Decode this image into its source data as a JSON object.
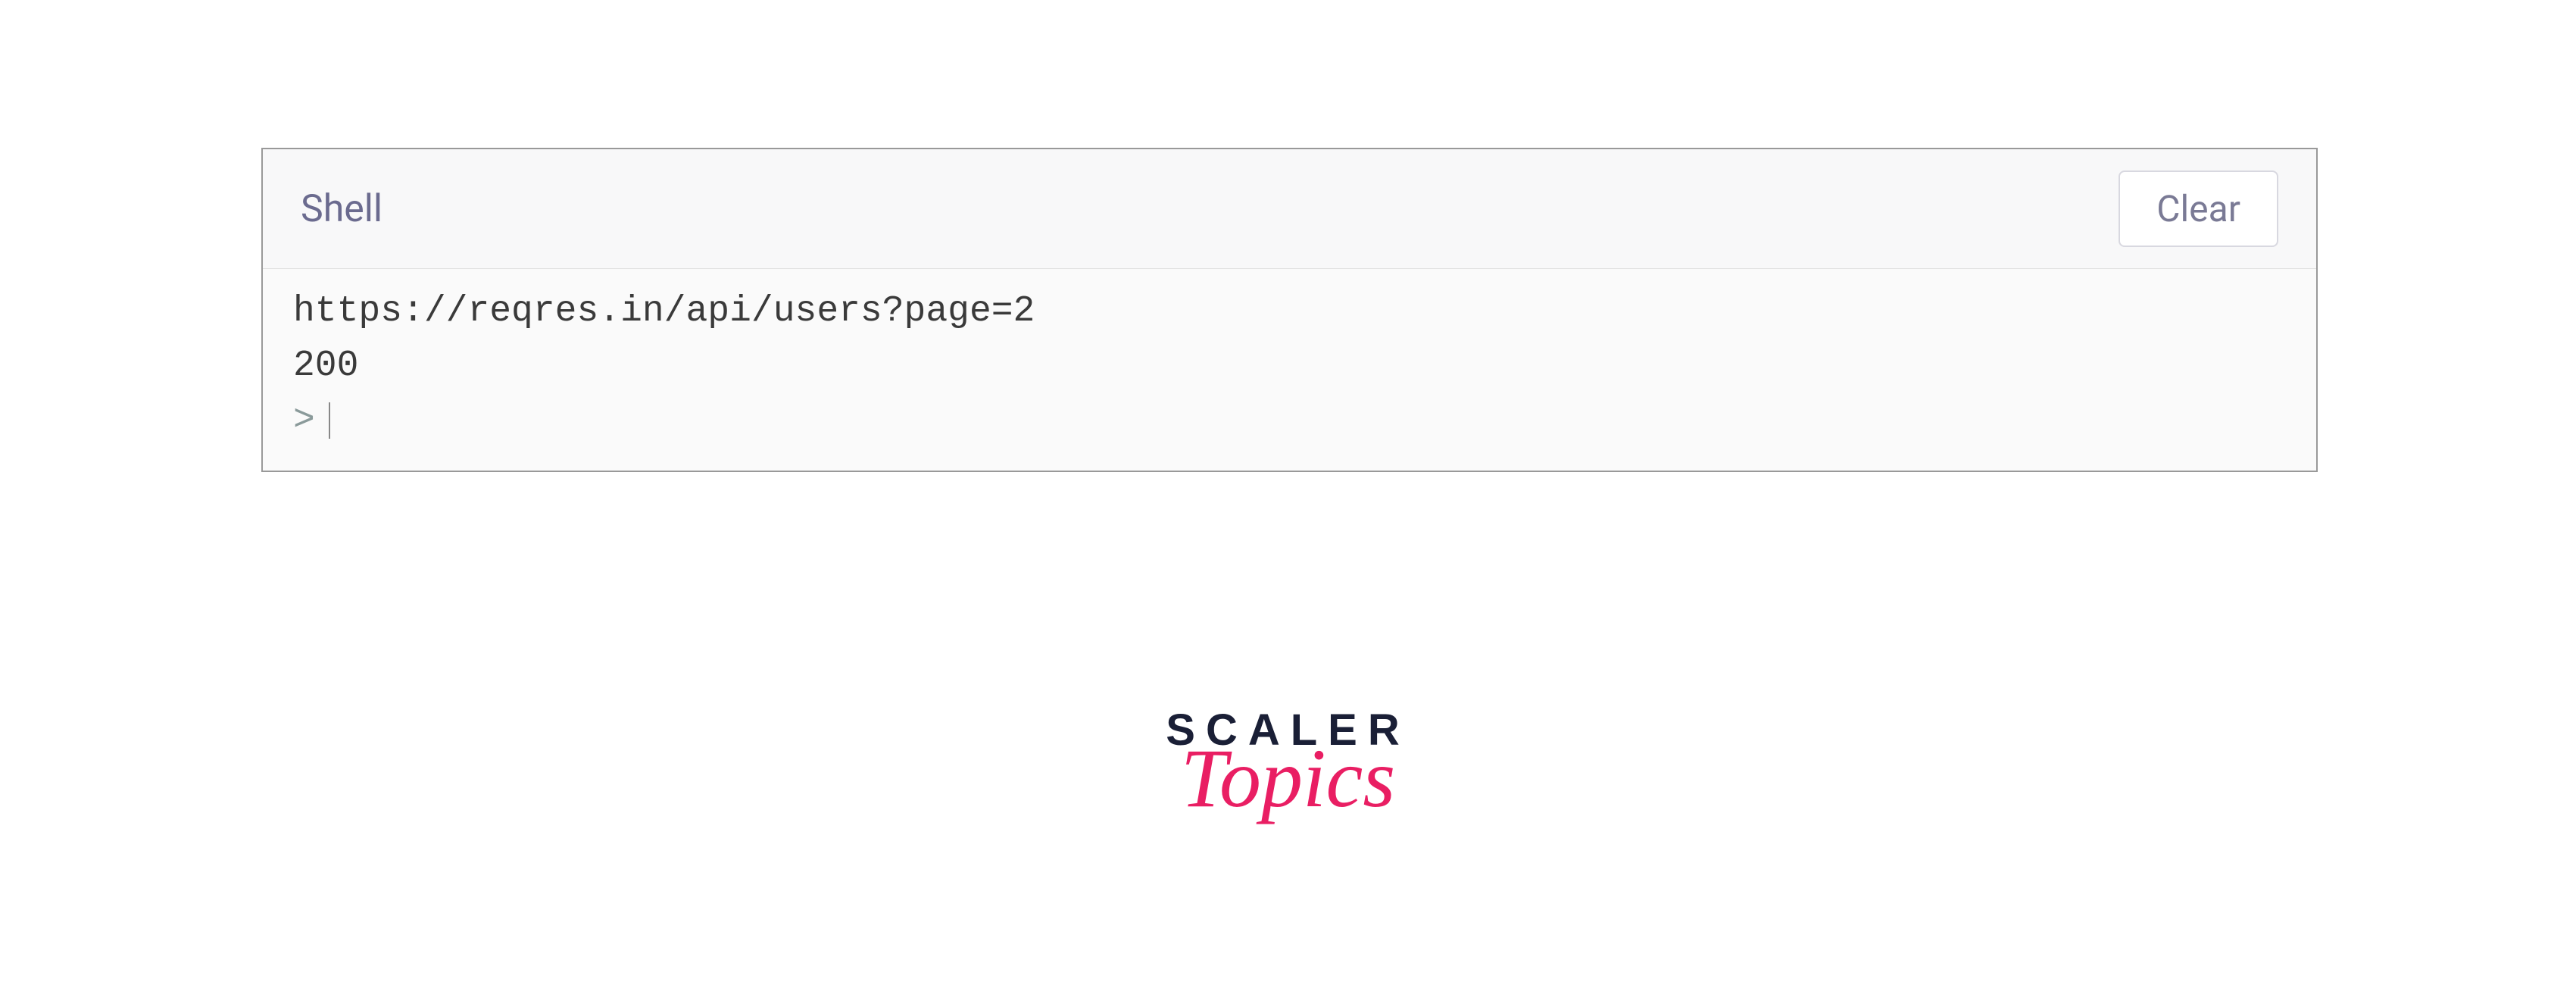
{
  "shell": {
    "title": "Shell",
    "clear_label": "Clear",
    "output_lines": [
      "https://reqres.in/api/users?page=2",
      "200"
    ],
    "prompt_symbol": ">"
  },
  "logo": {
    "line1": "SCALER",
    "line2": "Topics"
  }
}
